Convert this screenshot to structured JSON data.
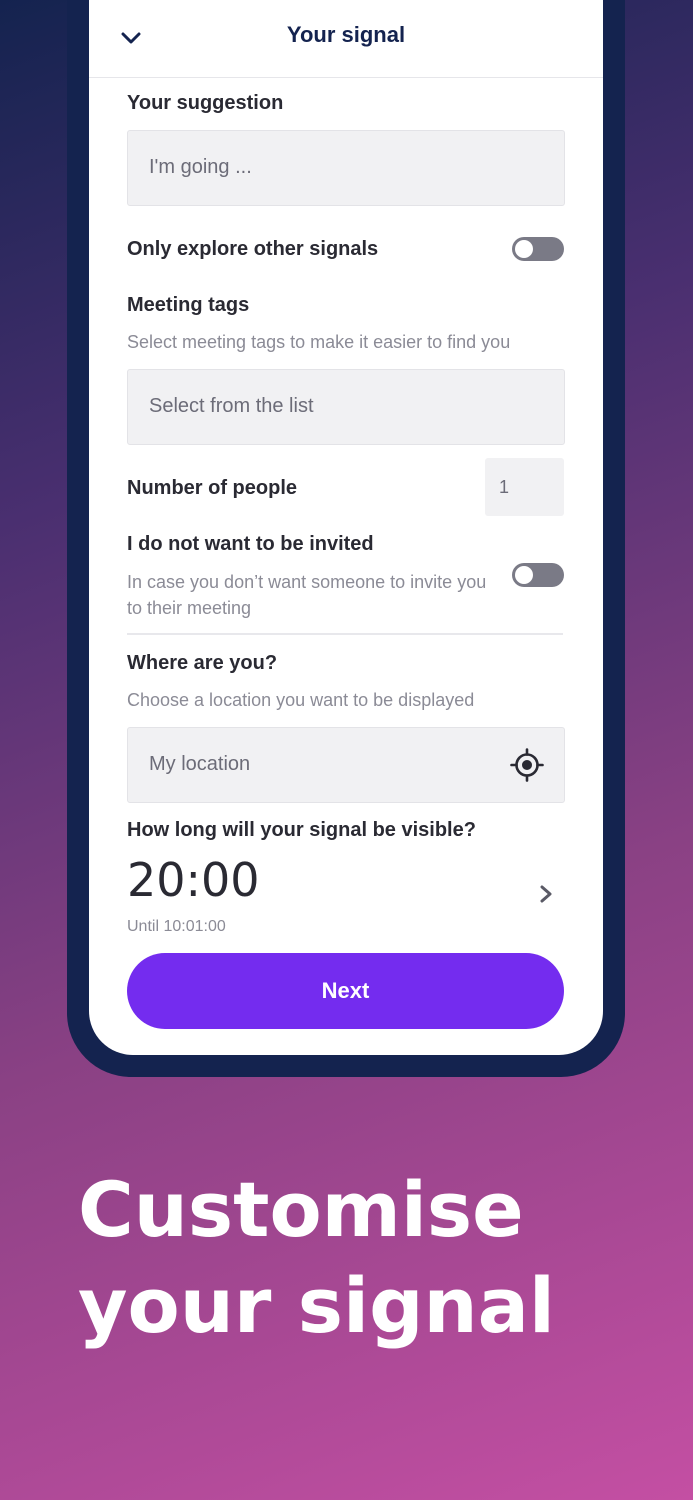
{
  "header": {
    "title": "Your signal",
    "back_icon": "chevron-down-icon"
  },
  "suggestion": {
    "label": "Your suggestion",
    "placeholder": "I'm going ..."
  },
  "explore_only": {
    "label": "Only explore other signals",
    "enabled": false
  },
  "meeting_tags": {
    "label": "Meeting tags",
    "hint": "Select meeting tags to make it easier to find you",
    "placeholder": "Select from the list"
  },
  "people": {
    "label": "Number of people",
    "value": "1"
  },
  "no_invites": {
    "label": "I do not want to be invited",
    "hint": "In case you don’t want someone to invite you to their meeting",
    "enabled": false
  },
  "location": {
    "label": "Where are you?",
    "hint": "Choose a location you want to be displayed",
    "placeholder": "My location",
    "icon": "locate-icon"
  },
  "visibility": {
    "label": "How long will your signal be visible?",
    "duration": "20:00",
    "until": "Until 10:01:00"
  },
  "next_label": "Next",
  "headline": {
    "line1": "Customise",
    "line2": "your signal"
  },
  "colors": {
    "accent": "#742cef",
    "navy": "#14234f",
    "toggle_off": "#7a7a86"
  }
}
